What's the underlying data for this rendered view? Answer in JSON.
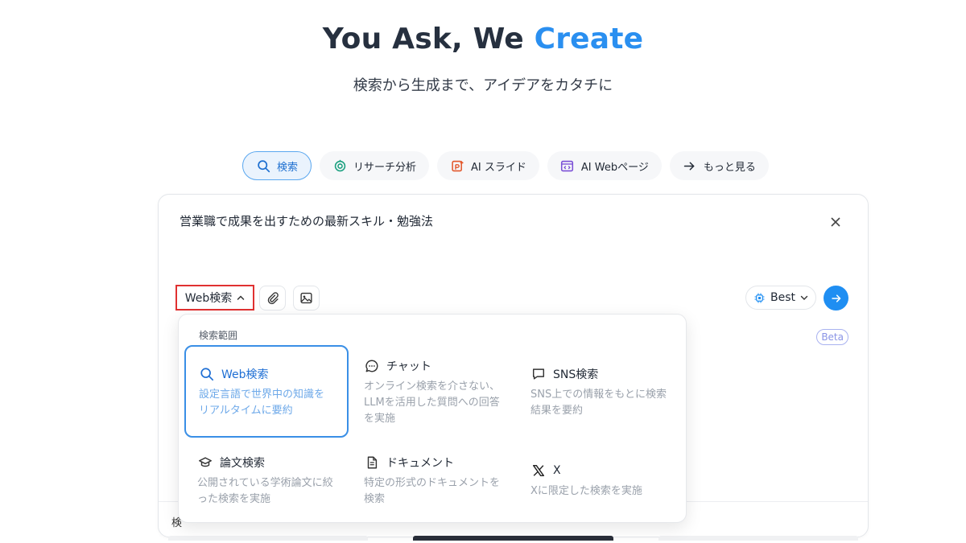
{
  "hero": {
    "title_main": "You Ask, We ",
    "title_accent": "Create",
    "subtitle": "検索から生成まで、アイデアをカタチに"
  },
  "tabs": [
    {
      "label": "検索",
      "icon": "search-icon",
      "active": true
    },
    {
      "label": "リサーチ分析",
      "icon": "research-icon",
      "active": false
    },
    {
      "label": "AI スライド",
      "icon": "slide-icon",
      "active": false
    },
    {
      "label": "AI Webページ",
      "icon": "webpage-icon",
      "active": false
    },
    {
      "label": "もっと見る",
      "icon": "arrow-right-icon",
      "active": false
    }
  ],
  "composer": {
    "query": "営業職で成果を出すための最新スキル・勉強法",
    "search_mode_label": "Web検索",
    "model_label": "Best",
    "badge": "Beta",
    "footer_label": "検"
  },
  "dropdown": {
    "title": "検索範囲",
    "options": [
      {
        "label": "Web検索",
        "icon": "search-icon",
        "desc": "設定言語で世界中の知識をリアルタイムに要約",
        "selected": true
      },
      {
        "label": "チャット",
        "icon": "chat-icon",
        "desc": "オンライン検索を介さない、LLMを活用した質問への回答を実施",
        "selected": false
      },
      {
        "label": "SNS検索",
        "icon": "comment-icon",
        "desc": "SNS上での情報をもとに検索結果を要約",
        "selected": false
      },
      {
        "label": "論文検索",
        "icon": "graduation-cap-icon",
        "desc": "公開されている学術論文に絞った検索を実施",
        "selected": false
      },
      {
        "label": "ドキュメント",
        "icon": "document-icon",
        "desc": "特定の形式のドキュメントを検索",
        "selected": false
      },
      {
        "label": "X",
        "icon": "x-logo-icon",
        "desc": "Xに限定した検索を実施",
        "selected": false
      }
    ]
  },
  "colors": {
    "accent": "#2a8ff0",
    "highlight_border": "#e03131",
    "send_button": "#1f8ef2"
  }
}
